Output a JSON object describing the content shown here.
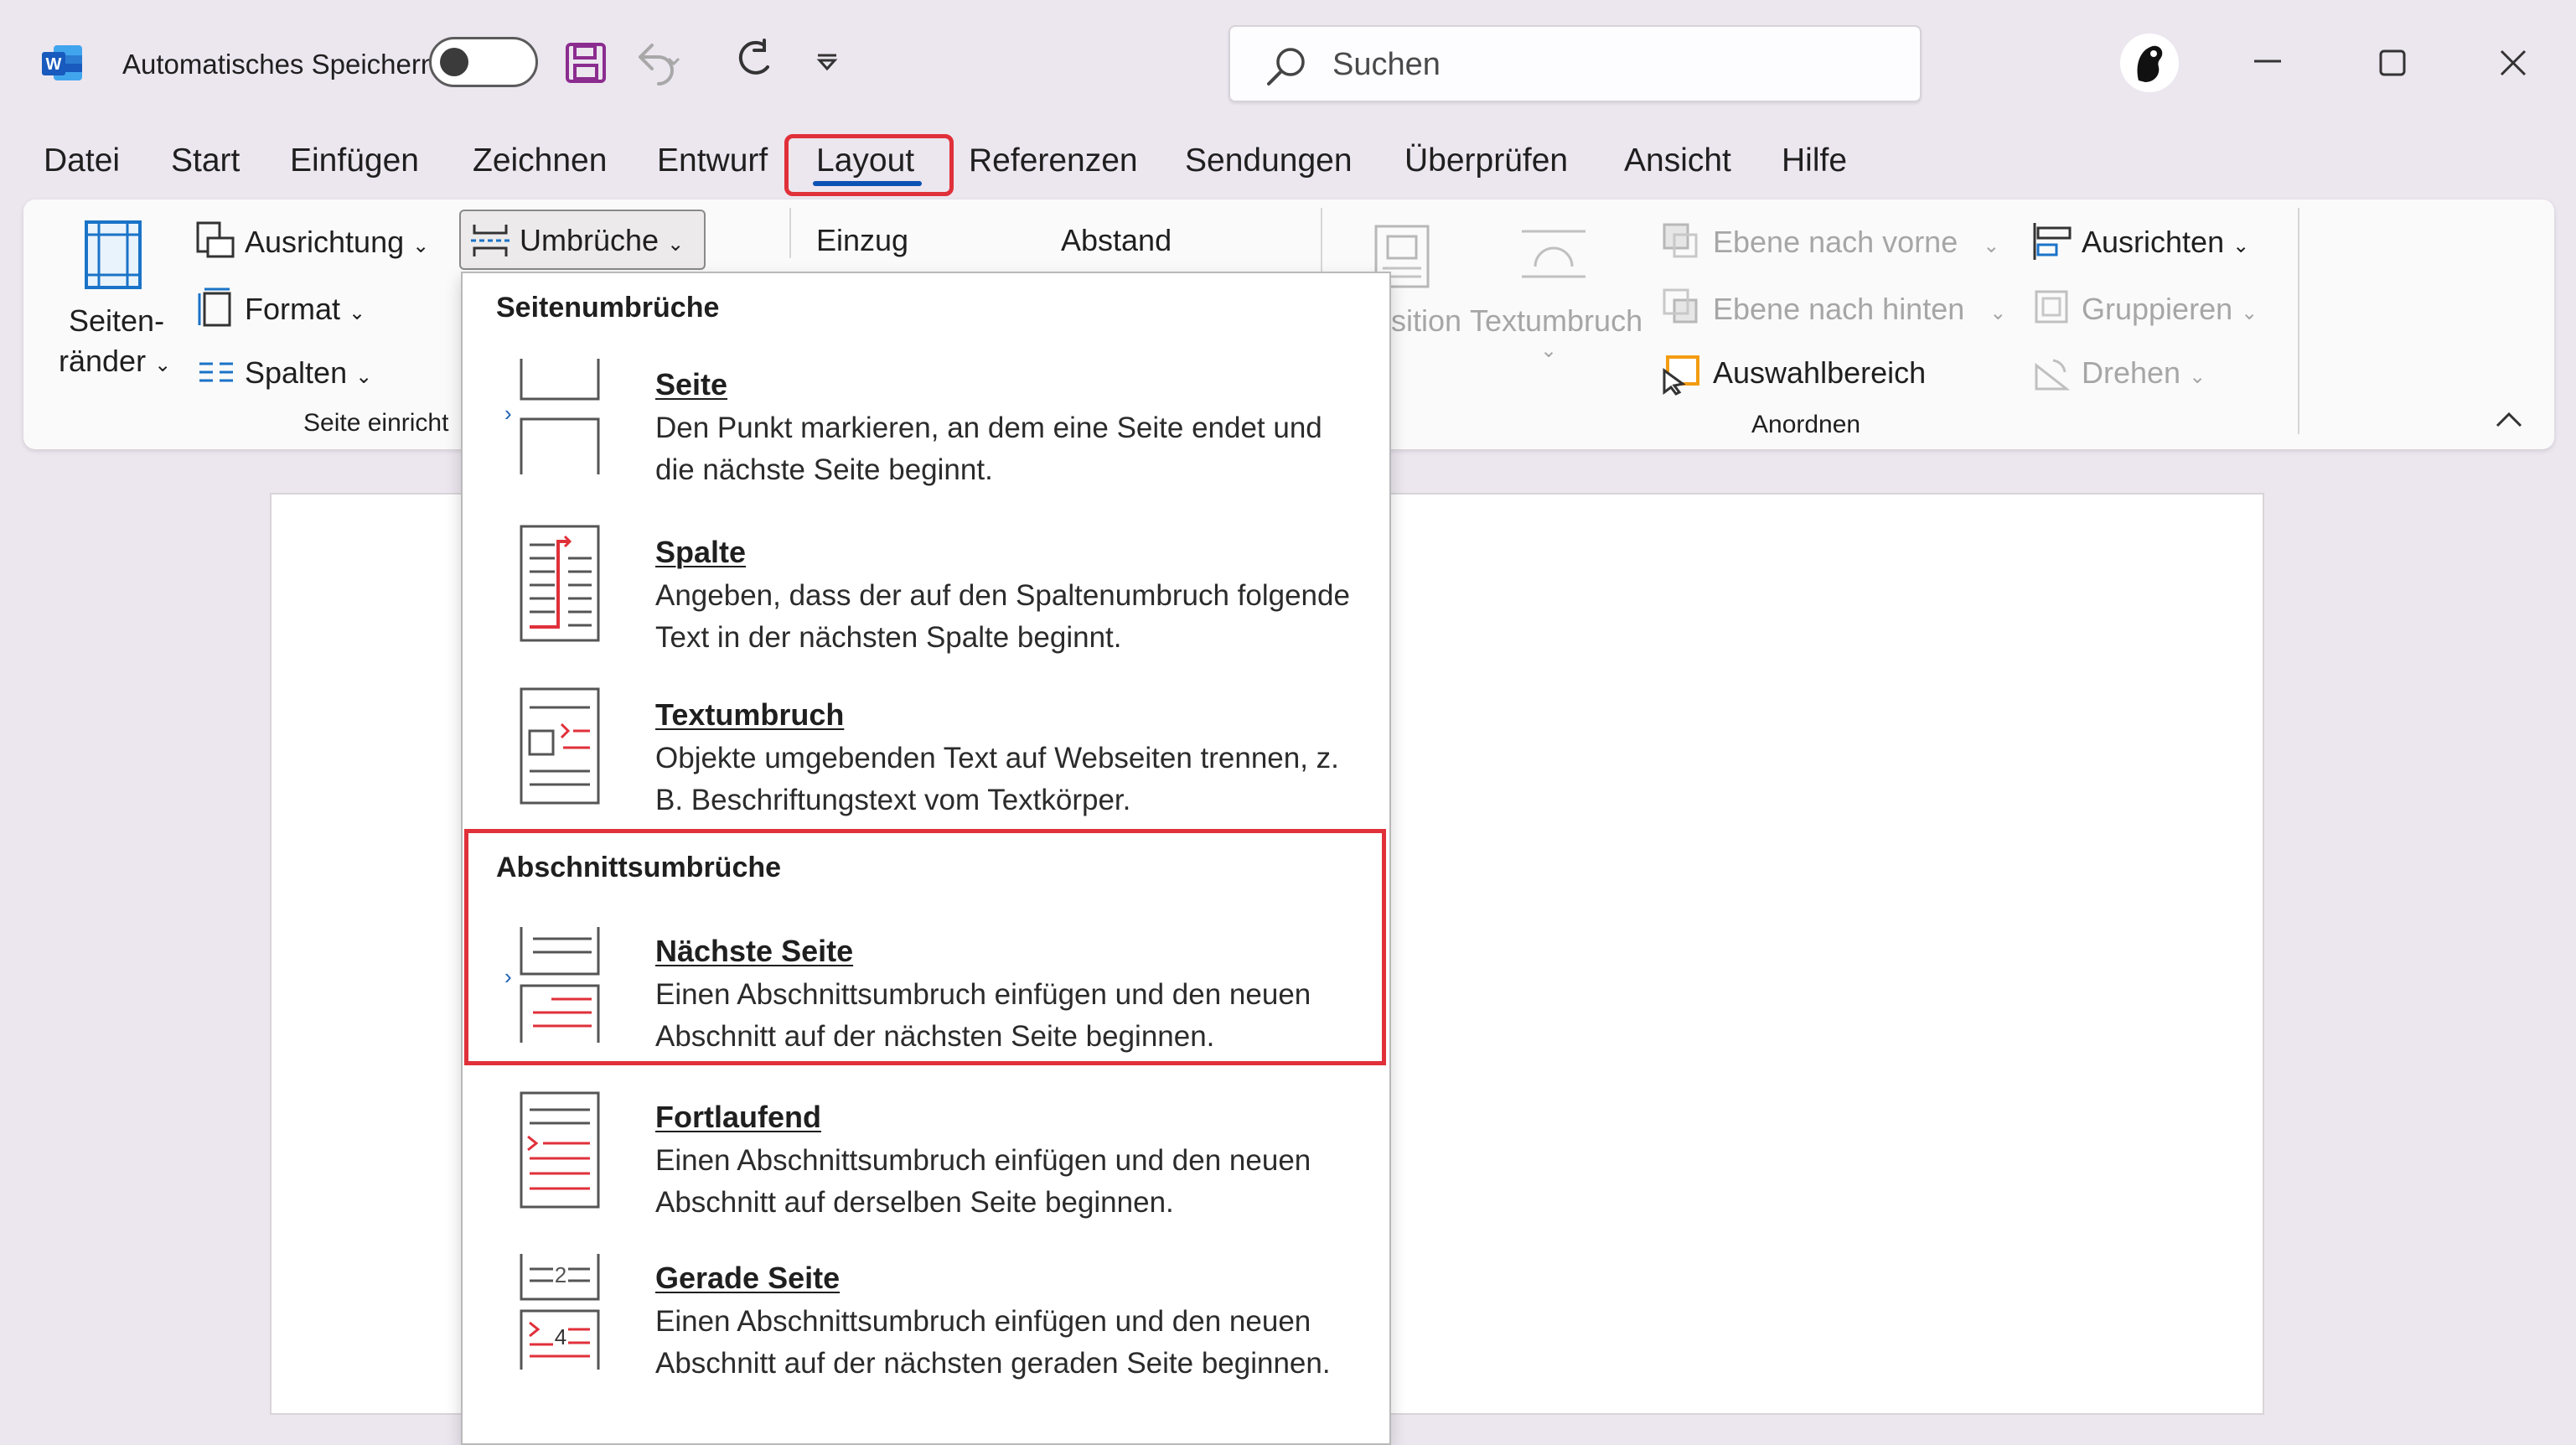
{
  "titlebar": {
    "autosave_label": "Automatisches Speichern",
    "search_placeholder": "Suchen"
  },
  "tabs": [
    "Datei",
    "Start",
    "Einfügen",
    "Zeichnen",
    "Entwurf",
    "Layout",
    "Referenzen",
    "Sendungen",
    "Überprüfen",
    "Ansicht",
    "Hilfe"
  ],
  "active_tab": "Layout",
  "ribbon": {
    "margins_label_1": "Seiten-",
    "margins_label_2": "ränder",
    "ausrichtung": "Ausrichtung",
    "format": "Format",
    "spalten": "Spalten",
    "umbrueche": "Umbrüche",
    "einzug": "Einzug",
    "abstand": "Abstand",
    "position_partial": "sition",
    "textumbruch": "Textumbruch",
    "ebene_vorne": "Ebene nach vorne",
    "ebene_hinten": "Ebene nach hinten",
    "auswahlbereich": "Auswahlbereich",
    "ausrichten": "Ausrichten",
    "gruppieren": "Gruppieren",
    "drehen": "Drehen",
    "group_seite": "Seite einricht",
    "group_anordnen": "Anordnen"
  },
  "dropdown": {
    "section1": "Seitenumbrüche",
    "section2": "Abschnittsumbrüche",
    "items": [
      {
        "title": "Seite",
        "desc1": "Den Punkt markieren, an dem eine Seite endet und",
        "desc2": "die nächste Seite beginnt."
      },
      {
        "title": "Spalte",
        "desc1": "Angeben, dass der auf den Spaltenumbruch folgende",
        "desc2": "Text in der nächsten Spalte beginnt."
      },
      {
        "title": "Textumbruch",
        "desc1": "Objekte umgebenden Text auf Webseiten trennen, z.",
        "desc2": "B. Beschriftungstext vom Textkörper."
      },
      {
        "title": "Nächste Seite",
        "desc1": "Einen Abschnittsumbruch einfügen und den neuen",
        "desc2": "Abschnitt auf der nächsten Seite beginnen."
      },
      {
        "title": "Fortlaufend",
        "desc1": "Einen Abschnittsumbruch einfügen und den neuen",
        "desc2": "Abschnitt auf derselben Seite beginnen."
      },
      {
        "title": "Gerade Seite",
        "desc1": "Einen Abschnittsumbruch einfügen und den neuen",
        "desc2": "Abschnitt auf der nächsten geraden Seite beginnen."
      }
    ]
  },
  "colors": {
    "accent_blue": "#0b53b4",
    "highlight_red": "#e0303a",
    "save_purple": "#8b2c8f",
    "word_blue": "#185abd"
  }
}
